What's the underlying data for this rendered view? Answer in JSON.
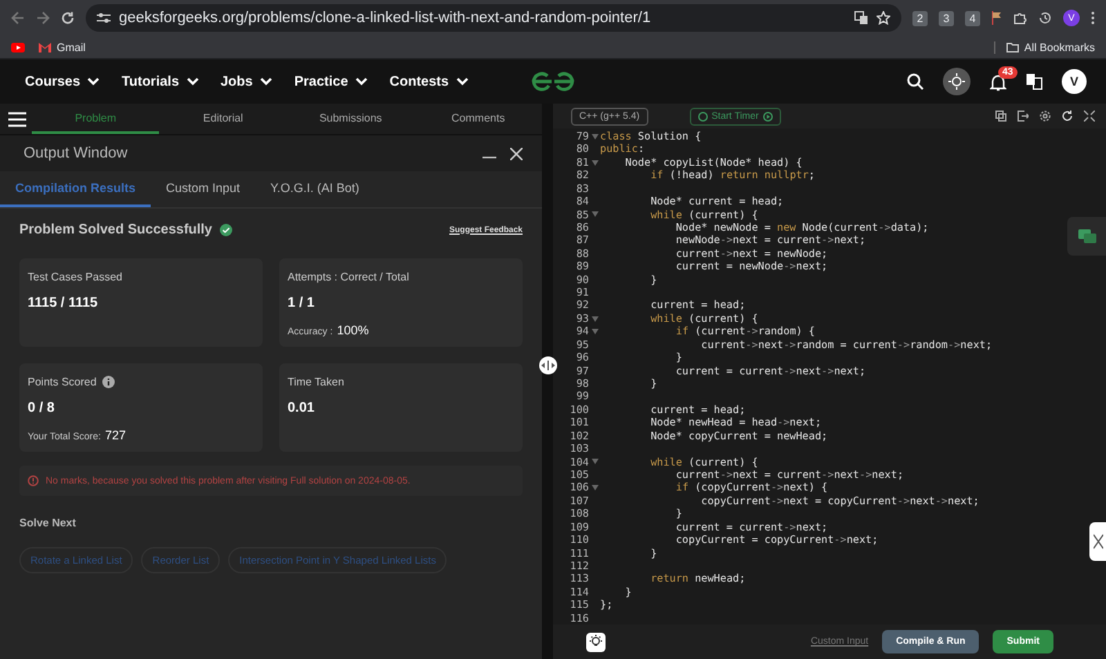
{
  "browser": {
    "url": "geeksforgeeks.org/problems/clone-a-linked-list-with-next-and-random-pointer/1",
    "extensions": [
      "2",
      "3",
      "4"
    ],
    "profile": "V",
    "bookmarks": [
      "Gmail"
    ],
    "all_bookmarks": "All Bookmarks"
  },
  "site_nav": {
    "items": [
      "Courses",
      "Tutorials",
      "Jobs",
      "Practice",
      "Contests"
    ],
    "notification_count": "43",
    "avatar": "V"
  },
  "problem_tabs": [
    {
      "label": "Problem",
      "selected": true
    },
    {
      "label": "Editorial",
      "selected": false
    },
    {
      "label": "Submissions",
      "selected": false
    },
    {
      "label": "Comments",
      "selected": false
    }
  ],
  "output_window": {
    "title": "Output Window",
    "tabs": [
      {
        "label": "Compilation Results",
        "selected": true
      },
      {
        "label": "Custom Input",
        "selected": false
      },
      {
        "label": "Y.O.G.I. (AI Bot)",
        "selected": false
      }
    ],
    "status": "Problem Solved Successfully",
    "suggest_feedback": "Suggest Feedback",
    "cards": [
      {
        "title": "Test Cases Passed",
        "value": "1115 / 1115",
        "info": false
      },
      {
        "title": "Attempts : Correct / Total",
        "value": "1 / 1",
        "note_label": "Accuracy :",
        "note_value": "100%",
        "info": false
      },
      {
        "title": "Points Scored",
        "value": "0 / 8",
        "note_label": "Your Total Score:",
        "note_value": "727",
        "info": true
      },
      {
        "title": "Time Taken",
        "value": "0.01",
        "info": false
      }
    ],
    "message": "No marks, because you solved this problem after visiting Full solution on 2024-08-05.",
    "solve_next": {
      "title": "Solve Next",
      "items": [
        "Rotate a Linked List",
        "Reorder List",
        "Intersection Point in Y Shaped Linked Lists"
      ]
    }
  },
  "editor": {
    "language": "C++ (g++ 5.4)",
    "timer": "Start Timer",
    "lines": [
      {
        "number": "79",
        "code": "class Solution {",
        "foldable": true
      },
      {
        "number": "80",
        "code": "public:",
        "foldable": false
      },
      {
        "number": "81",
        "code": "    Node* copyList(Node* head) {",
        "foldable": true
      },
      {
        "number": "82",
        "code": "        if (!head) return nullptr;",
        "foldable": false
      },
      {
        "number": "83",
        "foldable": false
      },
      {
        "number": "84",
        "code": "        Node* current = head;",
        "foldable": false
      },
      {
        "number": "85",
        "code": "        while (current) {",
        "foldable": true
      },
      {
        "number": "86",
        "code": "            Node* newNode = new Node(current->data);",
        "foldable": false
      },
      {
        "number": "87",
        "code": "            newNode->next = current->next;",
        "foldable": false
      },
      {
        "number": "88",
        "code": "            current->next = newNode;",
        "foldable": false
      },
      {
        "number": "89",
        "code": "            current = newNode->next;",
        "foldable": false
      },
      {
        "number": "90",
        "code": "        }",
        "foldable": false
      },
      {
        "number": "91",
        "foldable": false
      },
      {
        "number": "92",
        "code": "        current = head;",
        "foldable": false
      },
      {
        "number": "93",
        "code": "        while (current) {",
        "foldable": true
      },
      {
        "number": "94",
        "code": "            if (current->random) {",
        "foldable": true
      },
      {
        "number": "95",
        "code": "                current->next->random = current->random->next;",
        "foldable": false
      },
      {
        "number": "96",
        "code": "            }",
        "foldable": false
      },
      {
        "number": "97",
        "code": "            current = current->next->next;",
        "foldable": false
      },
      {
        "number": "98",
        "code": "        }",
        "foldable": false
      },
      {
        "number": "99",
        "foldable": false
      },
      {
        "number": "100",
        "code": "        current = head;",
        "foldable": false
      },
      {
        "number": "101",
        "code": "        Node* newHead = head->next;",
        "foldable": false
      },
      {
        "number": "102",
        "code": "        Node* copyCurrent = newHead;",
        "foldable": false
      },
      {
        "number": "103",
        "foldable": false
      },
      {
        "number": "104",
        "code": "        while (current) {",
        "foldable": true
      },
      {
        "number": "105",
        "code": "            current->next = current->next->next;",
        "foldable": false
      },
      {
        "number": "106",
        "code": "            if (copyCurrent->next) {",
        "foldable": true
      },
      {
        "number": "107",
        "code": "                copyCurrent->next = copyCurrent->next->next;",
        "foldable": false
      },
      {
        "number": "108",
        "code": "            }",
        "foldable": false
      },
      {
        "number": "109",
        "code": "            current = current->next;",
        "foldable": false
      },
      {
        "number": "110",
        "code": "            copyCurrent = copyCurrent->next;",
        "foldable": false
      },
      {
        "number": "111",
        "code": "        }",
        "foldable": false
      },
      {
        "number": "112",
        "foldable": false
      },
      {
        "number": "113",
        "code": "        return newHead;",
        "foldable": false
      },
      {
        "number": "114",
        "code": "    }",
        "foldable": false
      },
      {
        "number": "115",
        "code": "};",
        "foldable": false
      },
      {
        "number": "116",
        "foldable": false
      }
    ],
    "custom_input": "Custom Input",
    "compile_run": "Compile & Run",
    "submit": "Submit"
  }
}
